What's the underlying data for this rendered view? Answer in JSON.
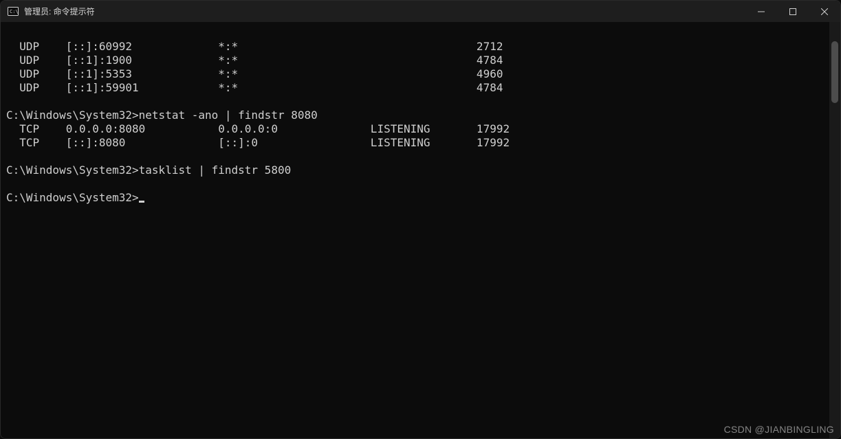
{
  "window": {
    "title": "管理员: 命令提示符"
  },
  "terminal": {
    "rows": {
      "r0": "  UDP    [::]:60992             *:*                                    2712",
      "r1": "  UDP    [::1]:1900             *:*                                    4784",
      "r2": "  UDP    [::1]:5353             *:*                                    4960",
      "r3": "  UDP    [::1]:59901            *:*                                    4784",
      "r4": "",
      "r5": "C:\\Windows\\System32>netstat -ano | findstr 8080",
      "r6": "  TCP    0.0.0.0:8080           0.0.0.0:0              LISTENING       17992",
      "r7": "  TCP    [::]:8080              [::]:0                 LISTENING       17992",
      "r8": "",
      "r9": "C:\\Windows\\System32>tasklist | findstr 5800",
      "r10": "",
      "r11_prefix": "C:\\Windows\\System32>"
    }
  },
  "watermark": "CSDN @JIANBINGLING"
}
